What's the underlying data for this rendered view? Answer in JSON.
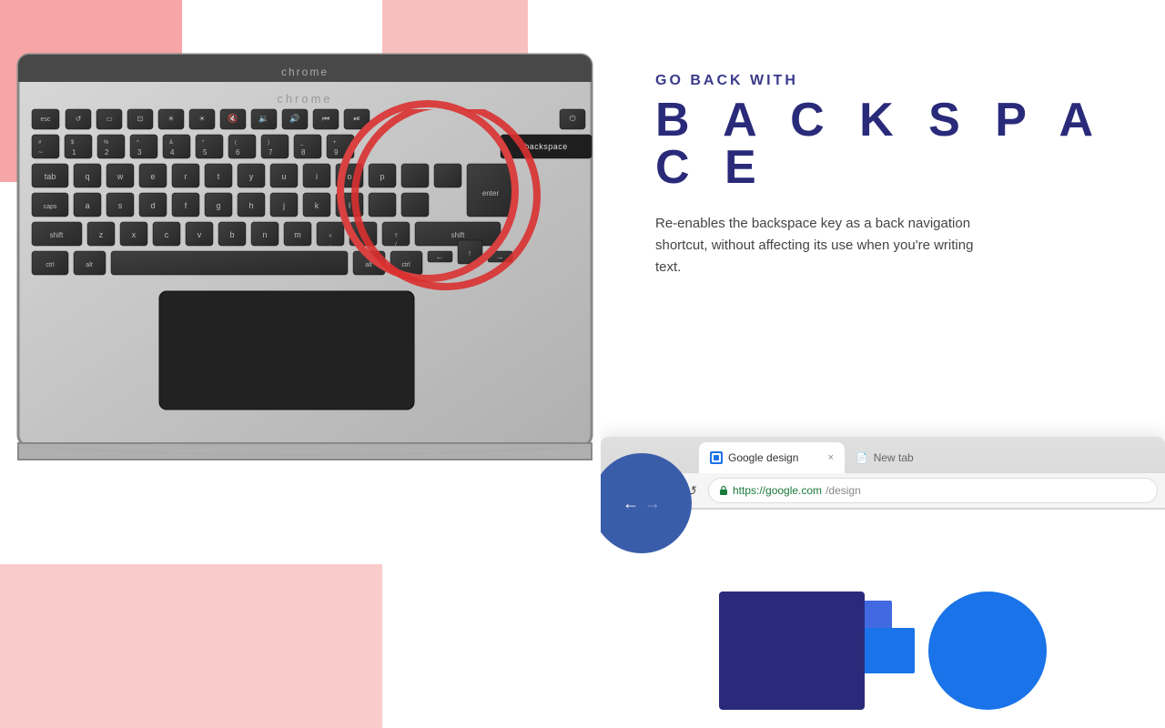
{
  "left": {
    "laptop_brand_screen": "chrome",
    "laptop_brand_keyboard": "chrome",
    "backspace_key_label": "backspace"
  },
  "right": {
    "subtitle": "GO BACK WITH",
    "main_title": "B A C K S P A C E",
    "description": "Re-enables the backspace key as a back navigation shortcut, without affecting its use when you're writing text.",
    "browser": {
      "active_tab_label": "Google design",
      "inactive_tab_label": "New tab",
      "url": "https://google.com/design",
      "url_green": "https://google.com",
      "url_gray": "/design",
      "back_arrow": "←",
      "forward_arrow": "→",
      "tab_close": "×",
      "new_tab_icon": "□"
    }
  }
}
